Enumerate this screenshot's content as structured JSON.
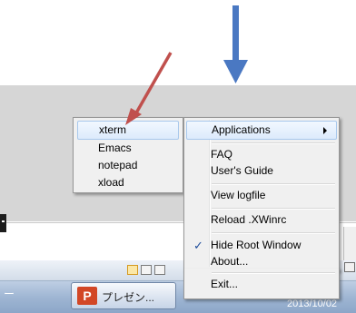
{
  "left_menu": {
    "items": [
      {
        "label": "xterm",
        "highlighted": true
      },
      {
        "label": "Emacs"
      },
      {
        "label": "notepad"
      },
      {
        "label": "xload"
      }
    ]
  },
  "main_menu": {
    "applications": {
      "label": "Applications",
      "highlighted": true
    },
    "faq": {
      "label": "FAQ"
    },
    "users_guide": {
      "label": "User's Guide"
    },
    "view_logfile": {
      "label": "View logfile"
    },
    "reload": {
      "label": "Reload .XWinrc"
    },
    "hide_root": {
      "label": "Hide Root Window",
      "checked": true,
      "check_glyph": "✓"
    },
    "about": {
      "label": "About..."
    },
    "exit": {
      "label": "Exit..."
    }
  },
  "taskbar": {
    "left_label": "ー",
    "task_button_label": "プレゼン...",
    "ppt_glyph": "P",
    "date": "2013/10/02"
  },
  "annotations": {
    "blue_arrow_color": "#4a78c2",
    "red_arrow_color": "#c0504d"
  }
}
